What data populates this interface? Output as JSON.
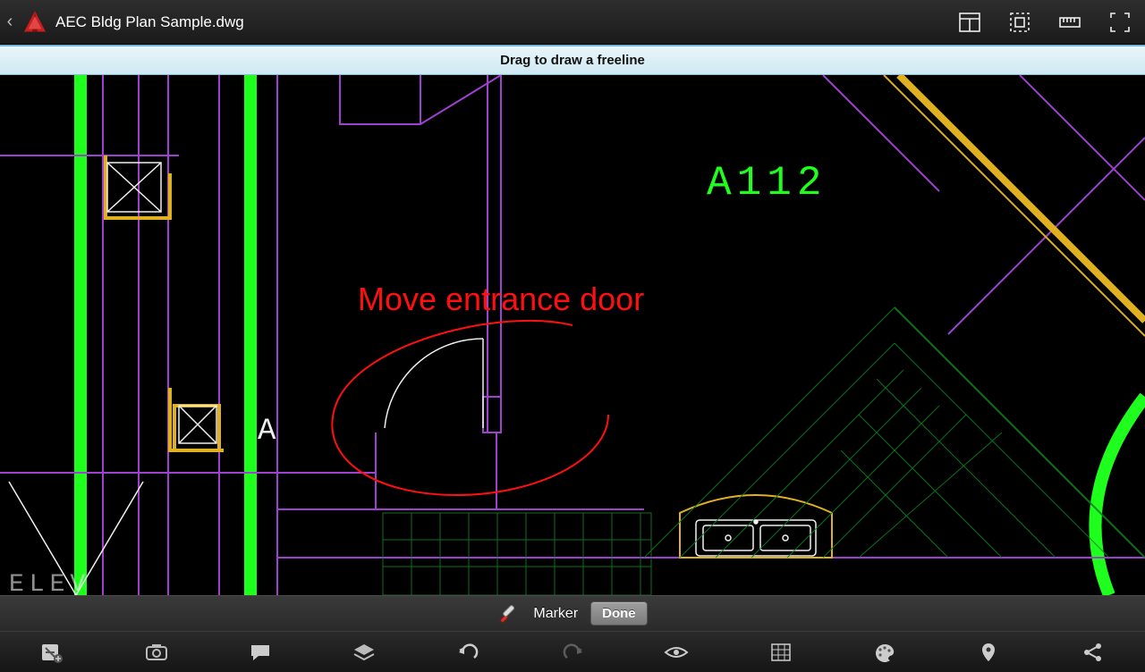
{
  "header": {
    "file_title": "AEC Bldg Plan Sample.dwg",
    "icons": [
      "view-mode",
      "select-area",
      "measure",
      "fullscreen"
    ]
  },
  "hint": {
    "text": "Drag to draw a freeline"
  },
  "canvas": {
    "annotation_text": "Move entrance door",
    "annotation_color": "#ff1010",
    "room_label": "A112",
    "small_label": "A",
    "bottom_left_label": "ELEV",
    "colors": {
      "green": "#1eff1e",
      "purple": "#a040d0",
      "yellow": "#e0b020",
      "white": "#f0f0f0",
      "darkgreen": "#108020",
      "red": "#ff1010"
    }
  },
  "context_bar": {
    "label": "Marker",
    "done_label": "Done"
  },
  "bottom_toolbar": {
    "tools": [
      "add-note",
      "camera",
      "comment",
      "layers",
      "undo",
      "redo",
      "visibility",
      "grid-snap",
      "palette",
      "marker-pin",
      "share"
    ]
  }
}
